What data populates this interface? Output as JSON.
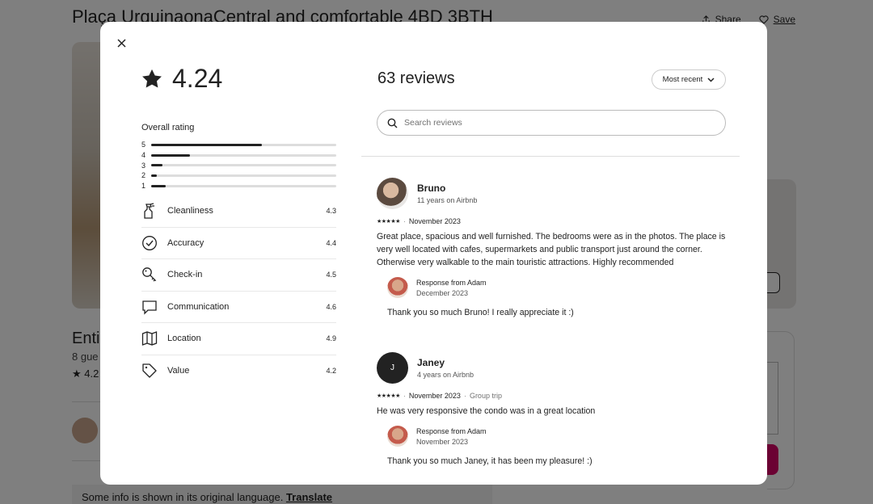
{
  "background": {
    "title": "Plaça UrquinaonaCentral and comfortable 4BD 3BTH",
    "share_label": "Share",
    "save_label": "Save",
    "entire_label": "Enti",
    "guests_label": "8 gue",
    "rating_short": "4.2",
    "info_text": "Some info is shown in its original language.",
    "translate_label": "Translate"
  },
  "modal": {
    "rating_value": "4.24",
    "overall_label": "Overall rating",
    "histogram": [
      {
        "stars": "5",
        "fraction": 0.6
      },
      {
        "stars": "4",
        "fraction": 0.21
      },
      {
        "stars": "3",
        "fraction": 0.06
      },
      {
        "stars": "2",
        "fraction": 0.03
      },
      {
        "stars": "1",
        "fraction": 0.08
      }
    ],
    "categories": [
      {
        "label": "Cleanliness",
        "value": "4.3",
        "icon": "spray-bottle-icon"
      },
      {
        "label": "Accuracy",
        "value": "4.4",
        "icon": "check-circle-icon"
      },
      {
        "label": "Check-in",
        "value": "4.5",
        "icon": "key-icon"
      },
      {
        "label": "Communication",
        "value": "4.6",
        "icon": "chat-bubble-icon"
      },
      {
        "label": "Location",
        "value": "4.9",
        "icon": "map-icon"
      },
      {
        "label": "Value",
        "value": "4.2",
        "icon": "tag-icon"
      }
    ],
    "reviews_title": "63 reviews",
    "sort_label": "Most recent",
    "search_placeholder": "Search reviews",
    "reviews": [
      {
        "name": "Bruno",
        "tenure": "11 years on Airbnb",
        "stars": "★★★★★",
        "date": "November 2023",
        "trip": "",
        "text": "Great place, spacious and well furnished. The bedrooms were as in the photos. The place is very well located with cafes, supermarkets and public transport just around the corner. Otherwise very walkable to the main touristic attractions. Highly recommended",
        "response_from": "Response from Adam",
        "response_date": "December 2023",
        "response_text": "Thank you so much Bruno! I really appreciate it :)"
      },
      {
        "name": "Janey",
        "initial": "J",
        "tenure": "4 years on Airbnb",
        "stars": "★★★★★",
        "date": "November 2023",
        "trip": "Group trip",
        "text": "He was very responsive the condo was in a great location",
        "response_from": "Response from Adam",
        "response_date": "November 2023",
        "response_text": "Thank you so much Janey, it has been my pleasure! :)"
      }
    ]
  }
}
